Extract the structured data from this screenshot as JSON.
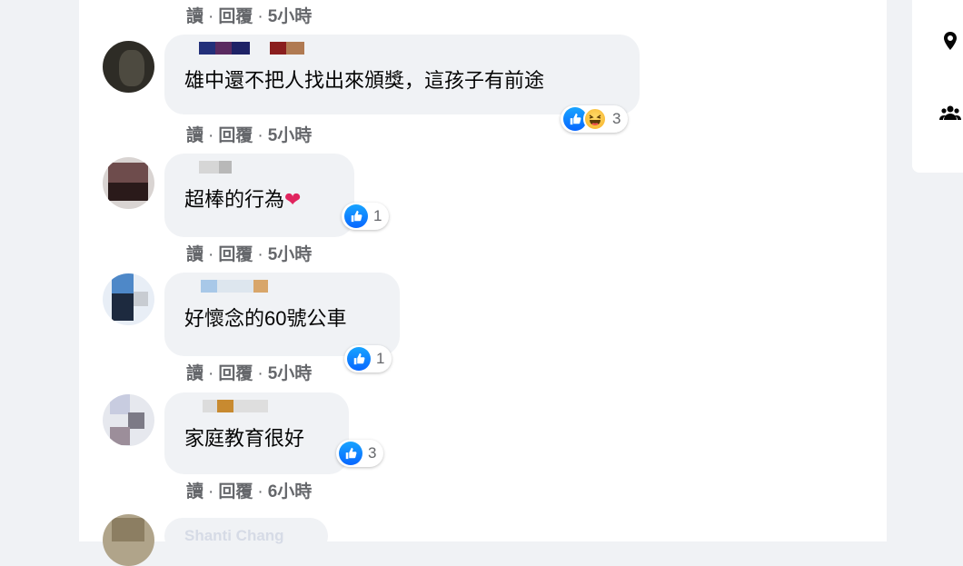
{
  "comments": [
    {
      "author": "",
      "text": "雄中還不把人找出來頒獎，這孩子有前途",
      "reaction_count": "3",
      "reaction_types": [
        "like",
        "haha"
      ],
      "actions": {
        "read": "讀",
        "reply": "回覆",
        "time": "5小時"
      }
    },
    {
      "author": "",
      "text": "超棒的行為",
      "reaction_count": "1",
      "reaction_types": [
        "like"
      ],
      "actions": {
        "read": "讀",
        "reply": "回覆",
        "time": "5小時"
      }
    },
    {
      "author": "",
      "text": "好懷念的60號公車",
      "reaction_count": "1",
      "reaction_types": [
        "like"
      ],
      "actions": {
        "read": "讀",
        "reply": "回覆",
        "time": "5小時"
      }
    },
    {
      "author": "",
      "text": "家庭教育很好",
      "reaction_count": "3",
      "reaction_types": [
        "like"
      ],
      "actions": {
        "read": "讀",
        "reply": "回覆",
        "time": "6小時"
      }
    }
  ],
  "top_actions": {
    "read": "讀",
    "reply": "回覆",
    "time": "5小時"
  },
  "partial_next_author": "Shanti Chang",
  "sidebar_icons": [
    "location-pin-icon",
    "group-icon"
  ],
  "colors": {
    "background": "#f0f2f5",
    "panel": "#ffffff",
    "bubble": "#f0f2f5",
    "text": "#050505",
    "secondary_text": "#65676b",
    "like_blue": "#0866ff",
    "heart_red": "#e0245e"
  }
}
